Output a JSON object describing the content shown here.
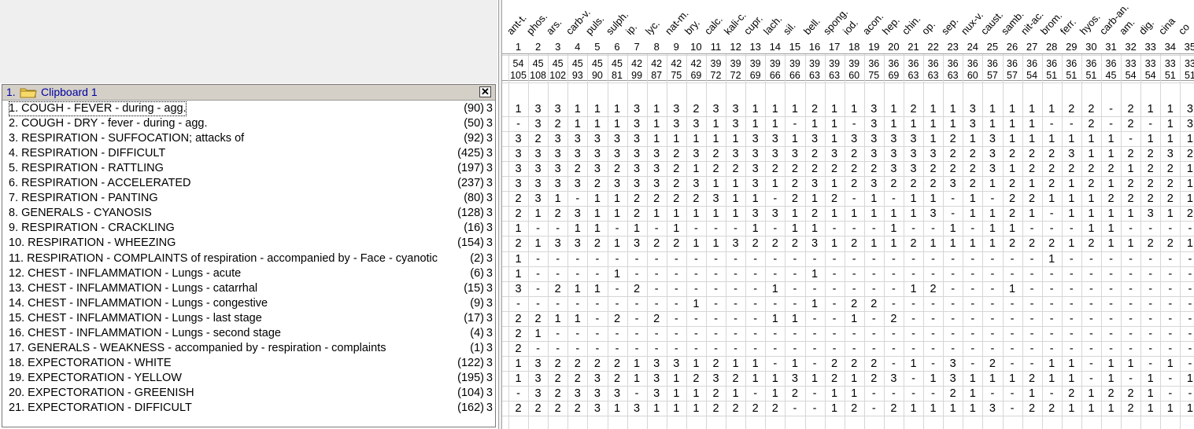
{
  "clipboard": {
    "index": "1.",
    "title": "Clipboard 1",
    "close_label": "✕",
    "folder_icon": "folder-icon"
  },
  "remedies": [
    "ant-t.",
    "phos.",
    "ars.",
    "carb-v.",
    "puls.",
    "sulph.",
    "ip.",
    "lyc.",
    "nat-m.",
    "bry.",
    "calc.",
    "kali-c.",
    "cupr.",
    "lach.",
    "sil.",
    "bell.",
    "spong.",
    "iod.",
    "acon.",
    "hep.",
    "chin.",
    "op.",
    "sep.",
    "nux-v.",
    "caust.",
    "samb.",
    "nit-ac.",
    "brom.",
    "ferr.",
    "hyos.",
    "carb-an.",
    "am.",
    "dig.",
    "cina",
    "co"
  ],
  "col_numbers": [
    "1",
    "2",
    "3",
    "4",
    "5",
    "6",
    "7",
    "8",
    "9",
    "10",
    "11",
    "12",
    "13",
    "14",
    "15",
    "16",
    "17",
    "18",
    "19",
    "20",
    "21",
    "22",
    "23",
    "24",
    "25",
    "26",
    "27",
    "28",
    "29",
    "30",
    "31",
    "32",
    "33",
    "34",
    "35"
  ],
  "symptoms_covered": [
    "54",
    "45",
    "45",
    "45",
    "45",
    "45",
    "42",
    "42",
    "42",
    "42",
    "39",
    "39",
    "39",
    "39",
    "39",
    "39",
    "39",
    "39",
    "36",
    "36",
    "36",
    "36",
    "36",
    "36",
    "36",
    "36",
    "36",
    "36",
    "36",
    "36",
    "36",
    "33",
    "33",
    "33",
    "33"
  ],
  "total_degree": [
    "105",
    "108",
    "102",
    "93",
    "90",
    "81",
    "99",
    "87",
    "75",
    "69",
    "72",
    "72",
    "69",
    "66",
    "66",
    "63",
    "63",
    "60",
    "75",
    "69",
    "63",
    "63",
    "63",
    "60",
    "57",
    "57",
    "54",
    "51",
    "51",
    "51",
    "45",
    "54",
    "54",
    "51",
    "51"
  ],
  "rubrics": [
    {
      "name": "1. COUGH - FEVER - during - agg.",
      "count": "(90)",
      "level": "3",
      "values": [
        "1",
        "3",
        "3",
        "1",
        "1",
        "1",
        "3",
        "1",
        "3",
        "2",
        "3",
        "3",
        "1",
        "1",
        "1",
        "2",
        "1",
        "1",
        "3",
        "1",
        "2",
        "1",
        "1",
        "3",
        "1",
        "1",
        "1",
        "1",
        "2",
        "2",
        "-",
        "2",
        "1",
        "1",
        "3"
      ]
    },
    {
      "name": "2. COUGH - DRY - fever - during - agg.",
      "count": "(50)",
      "level": "3",
      "values": [
        "-",
        "3",
        "2",
        "1",
        "1",
        "1",
        "3",
        "1",
        "3",
        "3",
        "1",
        "3",
        "1",
        "1",
        "-",
        "1",
        "1",
        "-",
        "3",
        "1",
        "1",
        "1",
        "1",
        "3",
        "1",
        "1",
        "1",
        "-",
        "-",
        "2",
        "-",
        "2",
        "-",
        "1",
        "3"
      ]
    },
    {
      "name": "3. RESPIRATION - SUFFOCATION; attacks of",
      "count": "(92)",
      "level": "3",
      "values": [
        "3",
        "2",
        "3",
        "3",
        "3",
        "3",
        "3",
        "1",
        "1",
        "1",
        "1",
        "1",
        "3",
        "3",
        "1",
        "3",
        "1",
        "3",
        "3",
        "3",
        "3",
        "1",
        "2",
        "1",
        "3",
        "1",
        "1",
        "1",
        "1",
        "1",
        "1",
        "-",
        "1",
        "1",
        "1"
      ]
    },
    {
      "name": "4. RESPIRATION - DIFFICULT",
      "count": "(425)",
      "level": "3",
      "values": [
        "3",
        "3",
        "3",
        "3",
        "3",
        "3",
        "3",
        "3",
        "2",
        "3",
        "2",
        "3",
        "3",
        "3",
        "3",
        "2",
        "3",
        "2",
        "3",
        "3",
        "3",
        "3",
        "2",
        "2",
        "3",
        "2",
        "2",
        "2",
        "3",
        "1",
        "1",
        "2",
        "2",
        "3",
        "2"
      ]
    },
    {
      "name": "5. RESPIRATION - RATTLING",
      "count": "(197)",
      "level": "3",
      "values": [
        "3",
        "3",
        "3",
        "2",
        "3",
        "2",
        "3",
        "3",
        "2",
        "1",
        "2",
        "2",
        "3",
        "2",
        "2",
        "2",
        "2",
        "2",
        "2",
        "3",
        "3",
        "2",
        "2",
        "2",
        "3",
        "1",
        "2",
        "2",
        "2",
        "2",
        "2",
        "1",
        "2",
        "2",
        "1"
      ]
    },
    {
      "name": "6. RESPIRATION - ACCELERATED",
      "count": "(237)",
      "level": "3",
      "values": [
        "3",
        "3",
        "3",
        "3",
        "2",
        "3",
        "3",
        "3",
        "2",
        "3",
        "1",
        "1",
        "3",
        "1",
        "2",
        "3",
        "1",
        "2",
        "3",
        "2",
        "2",
        "2",
        "3",
        "2",
        "1",
        "2",
        "1",
        "2",
        "1",
        "2",
        "1",
        "2",
        "2",
        "2",
        "1"
      ]
    },
    {
      "name": "7. RESPIRATION - PANTING",
      "count": "(80)",
      "level": "3",
      "values": [
        "2",
        "3",
        "1",
        "-",
        "1",
        "1",
        "2",
        "2",
        "2",
        "2",
        "3",
        "1",
        "1",
        "-",
        "2",
        "1",
        "2",
        "-",
        "1",
        "-",
        "1",
        "1",
        "-",
        "1",
        "-",
        "2",
        "2",
        "1",
        "1",
        "1",
        "2",
        "2",
        "2",
        "2",
        "1"
      ]
    },
    {
      "name": "8. GENERALS - CYANOSIS",
      "count": "(128)",
      "level": "3",
      "values": [
        "2",
        "1",
        "2",
        "3",
        "1",
        "1",
        "2",
        "1",
        "1",
        "1",
        "1",
        "1",
        "3",
        "3",
        "1",
        "2",
        "1",
        "1",
        "1",
        "1",
        "1",
        "3",
        "-",
        "1",
        "1",
        "2",
        "1",
        "-",
        "1",
        "1",
        "1",
        "1",
        "3",
        "1",
        "2"
      ]
    },
    {
      "name": "9. RESPIRATION - CRACKLING",
      "count": "(16)",
      "level": "3",
      "values": [
        "1",
        "-",
        "-",
        "1",
        "1",
        "-",
        "1",
        "-",
        "1",
        "-",
        "-",
        "-",
        "1",
        "-",
        "1",
        "1",
        "-",
        "-",
        "-",
        "1",
        "-",
        "-",
        "1",
        "-",
        "1",
        "1",
        "-",
        "-",
        "-",
        "1",
        "1",
        "-",
        "-",
        "-",
        "-"
      ]
    },
    {
      "name": "10. RESPIRATION - WHEEZING",
      "count": "(154)",
      "level": "3",
      "values": [
        "2",
        "1",
        "3",
        "3",
        "2",
        "1",
        "3",
        "2",
        "2",
        "1",
        "1",
        "3",
        "2",
        "2",
        "2",
        "3",
        "1",
        "2",
        "1",
        "1",
        "2",
        "1",
        "1",
        "1",
        "1",
        "2",
        "2",
        "2",
        "1",
        "2",
        "1",
        "1",
        "2",
        "2",
        "1"
      ]
    },
    {
      "name": "11. RESPIRATION - COMPLAINTS of respiration - accompanied by - Face - cyanotic",
      "count": "(2)",
      "level": "3",
      "values": [
        "1",
        "-",
        "-",
        "-",
        "-",
        "-",
        "-",
        "-",
        "-",
        "-",
        "-",
        "-",
        "-",
        "-",
        "-",
        "-",
        "-",
        "-",
        "-",
        "-",
        "-",
        "-",
        "-",
        "-",
        "-",
        "-",
        "-",
        "1",
        "-",
        "-",
        "-",
        "-",
        "-",
        "-",
        "-"
      ]
    },
    {
      "name": "12. CHEST - INFLAMMATION - Lungs - acute",
      "count": "(6)",
      "level": "3",
      "values": [
        "1",
        "-",
        "-",
        "-",
        "-",
        "1",
        "-",
        "-",
        "-",
        "-",
        "-",
        "-",
        "-",
        "-",
        "-",
        "1",
        "-",
        "-",
        "-",
        "-",
        "-",
        "-",
        "-",
        "-",
        "-",
        "-",
        "-",
        "-",
        "-",
        "-",
        "-",
        "-",
        "-",
        "-",
        "-"
      ]
    },
    {
      "name": "13. CHEST - INFLAMMATION - Lungs - catarrhal",
      "count": "(15)",
      "level": "3",
      "values": [
        "3",
        "-",
        "2",
        "1",
        "1",
        "-",
        "2",
        "-",
        "-",
        "-",
        "-",
        "-",
        "-",
        "1",
        "-",
        "-",
        "-",
        "-",
        "-",
        "-",
        "1",
        "2",
        "-",
        "-",
        "-",
        "1",
        "-",
        "-",
        "-",
        "-",
        "-",
        "-",
        "-",
        "-",
        "-"
      ]
    },
    {
      "name": "14. CHEST - INFLAMMATION - Lungs - congestive",
      "count": "(9)",
      "level": "3",
      "values": [
        "-",
        "-",
        "-",
        "-",
        "-",
        "-",
        "-",
        "-",
        "-",
        "1",
        "-",
        "-",
        "-",
        "-",
        "-",
        "1",
        "-",
        "2",
        "2",
        "-",
        "-",
        "-",
        "-",
        "-",
        "-",
        "-",
        "-",
        "-",
        "-",
        "-",
        "-",
        "-",
        "-",
        "-",
        "-"
      ]
    },
    {
      "name": "15. CHEST - INFLAMMATION - Lungs - last stage",
      "count": "(17)",
      "level": "3",
      "values": [
        "2",
        "2",
        "1",
        "1",
        "-",
        "2",
        "-",
        "2",
        "-",
        "-",
        "-",
        "-",
        "-",
        "1",
        "1",
        "-",
        "-",
        "1",
        "-",
        "2",
        "-",
        "-",
        "-",
        "-",
        "-",
        "-",
        "-",
        "-",
        "-",
        "-",
        "-",
        "-",
        "-",
        "-",
        "-"
      ]
    },
    {
      "name": "16. CHEST - INFLAMMATION - Lungs - second stage",
      "count": "(4)",
      "level": "3",
      "values": [
        "2",
        "1",
        "-",
        "-",
        "-",
        "-",
        "-",
        "-",
        "-",
        "-",
        "-",
        "-",
        "-",
        "-",
        "-",
        "-",
        "-",
        "-",
        "-",
        "-",
        "-",
        "-",
        "-",
        "-",
        "-",
        "-",
        "-",
        "-",
        "-",
        "-",
        "-",
        "-",
        "-",
        "-",
        "-"
      ]
    },
    {
      "name": "17. GENERALS - WEAKNESS - accompanied by - respiration - complaints",
      "count": "(1)",
      "level": "3",
      "values": [
        "2",
        "-",
        "-",
        "-",
        "-",
        "-",
        "-",
        "-",
        "-",
        "-",
        "-",
        "-",
        "-",
        "-",
        "-",
        "-",
        "-",
        "-",
        "-",
        "-",
        "-",
        "-",
        "-",
        "-",
        "-",
        "-",
        "-",
        "-",
        "-",
        "-",
        "-",
        "-",
        "-",
        "-",
        "-"
      ]
    },
    {
      "name": "18. EXPECTORATION - WHITE",
      "count": "(122)",
      "level": "3",
      "values": [
        "1",
        "3",
        "2",
        "2",
        "2",
        "2",
        "1",
        "3",
        "3",
        "1",
        "2",
        "1",
        "1",
        "-",
        "1",
        "-",
        "2",
        "2",
        "2",
        "-",
        "1",
        "-",
        "3",
        "-",
        "2",
        "-",
        "-",
        "1",
        "1",
        "-",
        "1",
        "1",
        "-",
        "1",
        "-"
      ]
    },
    {
      "name": "19. EXPECTORATION - YELLOW",
      "count": "(195)",
      "level": "3",
      "values": [
        "1",
        "3",
        "2",
        "2",
        "3",
        "2",
        "1",
        "3",
        "1",
        "2",
        "3",
        "2",
        "1",
        "1",
        "3",
        "1",
        "2",
        "1",
        "2",
        "3",
        "-",
        "1",
        "3",
        "1",
        "1",
        "1",
        "2",
        "1",
        "1",
        "-",
        "1",
        "-",
        "1",
        "-",
        "1"
      ]
    },
    {
      "name": "20. EXPECTORATION - GREENISH",
      "count": "(104)",
      "level": "3",
      "values": [
        "-",
        "3",
        "2",
        "3",
        "3",
        "3",
        "-",
        "3",
        "1",
        "1",
        "2",
        "1",
        "-",
        "1",
        "2",
        "-",
        "1",
        "1",
        "-",
        "-",
        "-",
        "-",
        "2",
        "1",
        "-",
        "-",
        "1",
        "-",
        "2",
        "1",
        "2",
        "2",
        "1",
        "-",
        "-"
      ]
    },
    {
      "name": "21. EXPECTORATION - DIFFICULT",
      "count": "(162)",
      "level": "3",
      "values": [
        "2",
        "2",
        "2",
        "2",
        "3",
        "1",
        "3",
        "1",
        "1",
        "1",
        "2",
        "2",
        "2",
        "2",
        "-",
        "-",
        "1",
        "2",
        "-",
        "2",
        "1",
        "1",
        "1",
        "1",
        "3",
        "-",
        "2",
        "2",
        "1",
        "1",
        "1",
        "2",
        "1",
        "1",
        "1"
      ]
    }
  ]
}
